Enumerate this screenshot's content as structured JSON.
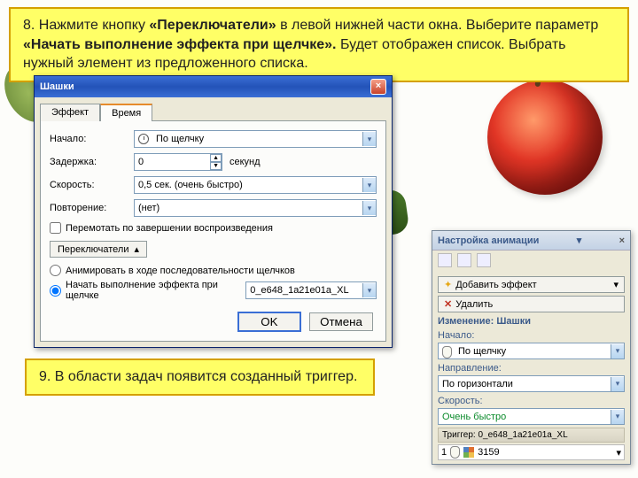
{
  "instructions": {
    "step8_prefix": "8. Нажмите кнопку ",
    "step8_b1": "«Переключатели»",
    "step8_mid1": " в левой нижней части окна. Выберите параметр ",
    "step8_b2": "«Начать выполнение эффекта при щелчке».",
    "step8_suffix": " Будет отображен список. Выбрать нужный элемент из предложенного списка.",
    "step9": "9. В области задач появится созданный триггер."
  },
  "dialog": {
    "title": "Шашки",
    "tabs": {
      "effect": "Эффект",
      "time": "Время"
    },
    "labels": {
      "start": "Начало:",
      "delay": "Задержка:",
      "speed": "Скорость:",
      "repeat": "Повторение:"
    },
    "values": {
      "start": "По щелчку",
      "delay": "0",
      "delay_unit": "секунд",
      "speed": "0,5 сек. (очень быстро)",
      "repeat": "(нет)"
    },
    "rewind": "Перемотать по завершении воспроизведения",
    "triggers_btn": "Переключатели",
    "radioA": "Анимировать в ходе последовательности щелчков",
    "radioB": "Начать выполнение эффекта при щелчке",
    "trigger_target": "0_e648_1a21e01a_XL",
    "ok": "OK",
    "cancel": "Отмена"
  },
  "pane": {
    "title": "Настройка анимации",
    "add_effect": "Добавить эффект",
    "remove": "Удалить",
    "change_label": "Изменение: Шашки",
    "start_label": "Начало:",
    "start_value": "По щелчку",
    "dir_label": "Направление:",
    "dir_value": "По горизонтали",
    "speed_label": "Скорость:",
    "speed_value": "Очень быстро",
    "trigger_label": "Триггер: 0_e648_1a21e01a_XL",
    "item_num": "1",
    "item_text": "3159"
  }
}
